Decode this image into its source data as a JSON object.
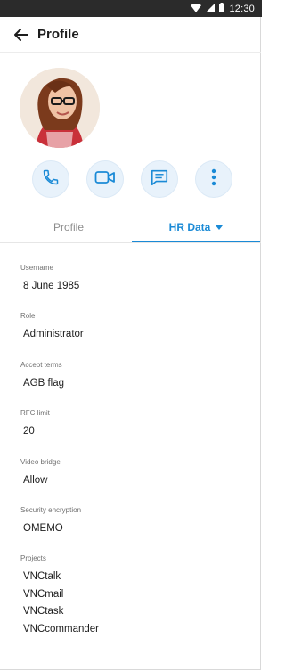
{
  "status_bar": {
    "time": "12:30"
  },
  "app_bar": {
    "title": "Profile"
  },
  "tabs": [
    {
      "label": "Profile",
      "active": false
    },
    {
      "label": "HR Data",
      "active": true
    }
  ],
  "colors": {
    "accent": "#1a8ad6",
    "status_bar": "#2b2b2b",
    "action_bg": "#e8f2fb"
  },
  "actions": [
    {
      "icon": "phone-icon"
    },
    {
      "icon": "video-camera-icon"
    },
    {
      "icon": "chat-icon"
    },
    {
      "icon": "more-vertical-icon"
    }
  ],
  "fields": {
    "username": {
      "label": "Username",
      "value": "8 June 1985"
    },
    "role": {
      "label": "Role",
      "value": "Administrator"
    },
    "accept_terms": {
      "label": "Accept terms",
      "value": "AGB flag"
    },
    "rfc_limit": {
      "label": "RFC limit",
      "value": "20"
    },
    "video_bridge": {
      "label": "Video bridge",
      "value": "Allow"
    },
    "security_encryption": {
      "label": "Security encryption",
      "value": "OMEMO"
    },
    "projects": {
      "label": "Projects",
      "values": [
        "VNCtalk",
        "VNCmail",
        "VNCtask",
        "VNCcommander"
      ]
    }
  }
}
